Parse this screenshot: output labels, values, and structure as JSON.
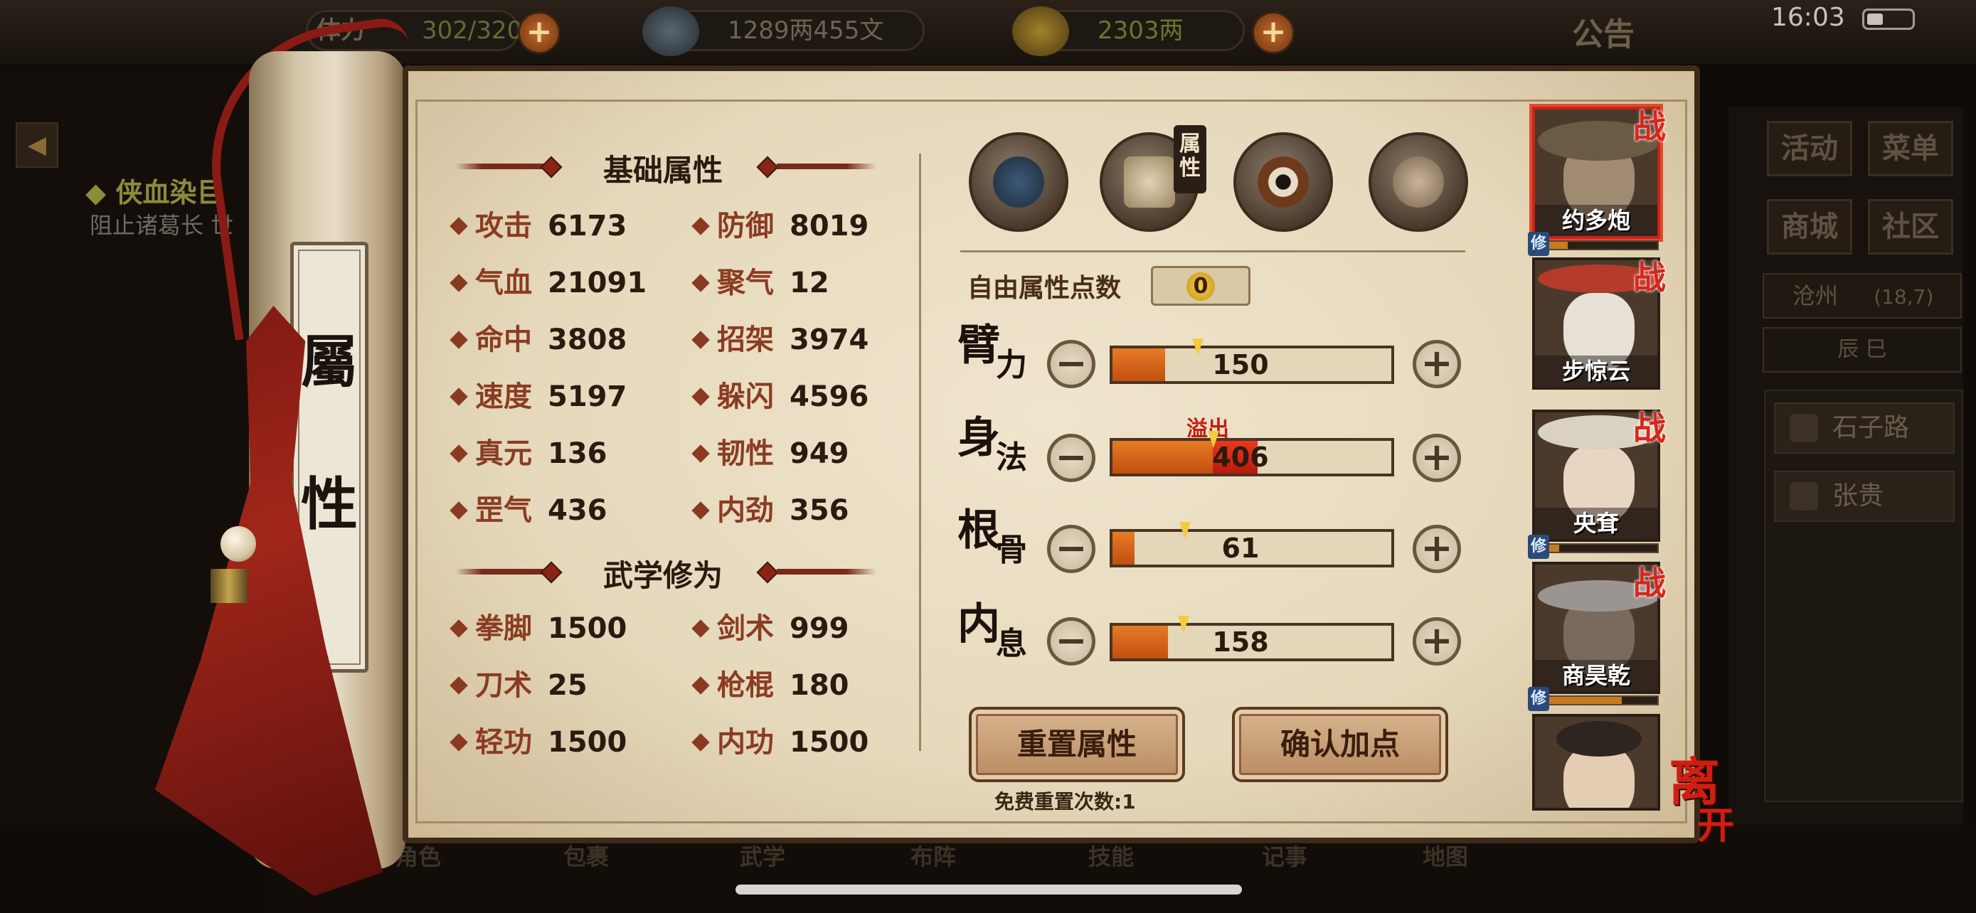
{
  "topbar": {
    "stamina_label": "体力",
    "stamina_value": "302/320",
    "silver_value": "1289两455文",
    "gold_value": "2303两",
    "plus_symbol": "+",
    "notice": "公告",
    "clock": "16:03"
  },
  "left_panel": {
    "quest_title": "◆ 侠血染巨",
    "quest_desc": "阻止诸葛长 世"
  },
  "scroll_seal": {
    "char1": "屬",
    "char2": "性"
  },
  "basic": {
    "title": "基础属性",
    "stats": [
      {
        "label": "攻击",
        "value": "6173"
      },
      {
        "label": "防御",
        "value": "8019"
      },
      {
        "label": "气血",
        "value": "21091"
      },
      {
        "label": "聚气",
        "value": "12"
      },
      {
        "label": "命中",
        "value": "3808"
      },
      {
        "label": "招架",
        "value": "3974"
      },
      {
        "label": "速度",
        "value": "5197"
      },
      {
        "label": "躲闪",
        "value": "4596"
      },
      {
        "label": "真元",
        "value": "136"
      },
      {
        "label": "韧性",
        "value": "949"
      },
      {
        "label": "罡气",
        "value": "436"
      },
      {
        "label": "内劲",
        "value": "356"
      }
    ]
  },
  "martial": {
    "title": "武学修为",
    "stats": [
      {
        "label": "拳脚",
        "value": "1500"
      },
      {
        "label": "剑术",
        "value": "999"
      },
      {
        "label": "刀术",
        "value": "25"
      },
      {
        "label": "枪棍",
        "value": "180"
      },
      {
        "label": "轻功",
        "value": "1500"
      },
      {
        "label": "内功",
        "value": "1500"
      }
    ]
  },
  "tabs": {
    "active_label": "属性"
  },
  "free_points": {
    "label": "自由属性点数",
    "value": "0"
  },
  "attributes": [
    {
      "name1": "臂",
      "name2": "力",
      "value": "150",
      "fill": 0.19,
      "over": 0
    },
    {
      "name1": "身",
      "name2": "法",
      "value": "406",
      "fill": 0.36,
      "over": 0.16,
      "overflow_label": "溢出"
    },
    {
      "name1": "根",
      "name2": "骨",
      "value": "61",
      "fill": 0.08,
      "over": 0
    },
    {
      "name1": "内",
      "name2": "息",
      "value": "158",
      "fill": 0.2,
      "over": 0
    }
  ],
  "controls": {
    "minus_symbol": "−",
    "plus_symbol": "+"
  },
  "buttons": {
    "reset": "重置属性",
    "confirm": "确认加点",
    "free_reset": "免费重置次数:1"
  },
  "party": [
    {
      "name": "约多炮",
      "tag": "战",
      "xiu": "修",
      "xiu_fill": 0.25
    },
    {
      "name": "步惊云",
      "tag": "战"
    },
    {
      "name": "央耷",
      "tag": "战",
      "xiu": "修",
      "xiu_fill": 0.18
    },
    {
      "name": "商昊乾",
      "tag": "战",
      "xiu": "修",
      "xiu_fill": 0.7
    },
    {
      "name": ""
    }
  ],
  "leave": {
    "char1": "离",
    "char2": "开"
  },
  "right_panel": {
    "menu": [
      "活动",
      "菜单",
      "商城",
      "社区"
    ],
    "location": "沧州",
    "coords": "(18,7)",
    "time": "辰 巳",
    "npcs": [
      "石子路",
      "张贵"
    ]
  },
  "bottom_nav": [
    "角色",
    "包裹",
    "武学",
    "布阵",
    "技能",
    "记事",
    "地图"
  ],
  "colors": {
    "accent_red": "#c8231a",
    "bar_fill": "#e67b26",
    "overflow": "#e83a1c"
  }
}
